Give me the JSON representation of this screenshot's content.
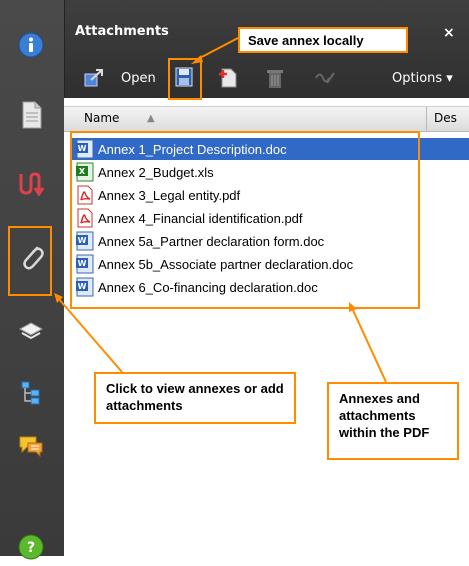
{
  "panel": {
    "title": "Attachments",
    "close_label": "×",
    "toolbar": {
      "open_label": "Open",
      "options_label": "Options ▾"
    },
    "columns": {
      "name": "Name",
      "sort_indicator": "▲",
      "description": "Des"
    },
    "files": [
      {
        "name": "Annex 1_Project Description.doc",
        "icon": "word-doc-icon",
        "selected": true
      },
      {
        "name": "Annex 2_Budget.xls",
        "icon": "excel-icon",
        "selected": false
      },
      {
        "name": "Annex 3_Legal entity.pdf",
        "icon": "pdf-icon",
        "selected": false
      },
      {
        "name": "Annex 4_Financial identification.pdf",
        "icon": "pdf-icon",
        "selected": false
      },
      {
        "name": "Annex 5a_Partner declaration form.doc",
        "icon": "word-doc-icon",
        "selected": false
      },
      {
        "name": "Annex 5b_Associate partner declaration.doc",
        "icon": "word-doc-icon",
        "selected": false
      },
      {
        "name": "Annex 6_Co-financing declaration.doc",
        "icon": "word-doc-icon",
        "selected": false
      }
    ]
  },
  "sidebar": {
    "items": [
      {
        "icon": "info-icon"
      },
      {
        "icon": "pages-icon"
      },
      {
        "icon": "signatures-icon"
      },
      {
        "icon": "paperclip-icon"
      },
      {
        "icon": "layers-icon"
      },
      {
        "icon": "model-tree-icon"
      },
      {
        "icon": "comments-icon"
      },
      {
        "icon": "help-icon"
      }
    ]
  },
  "annotations": {
    "save_annex": "Save annex locally",
    "view_annexes": "Click to view annexes or add attachments",
    "within_pdf": "Annexes and attachments within the PDF"
  },
  "colors": {
    "highlight": "#ff8c00",
    "selection": "#3169c6"
  }
}
